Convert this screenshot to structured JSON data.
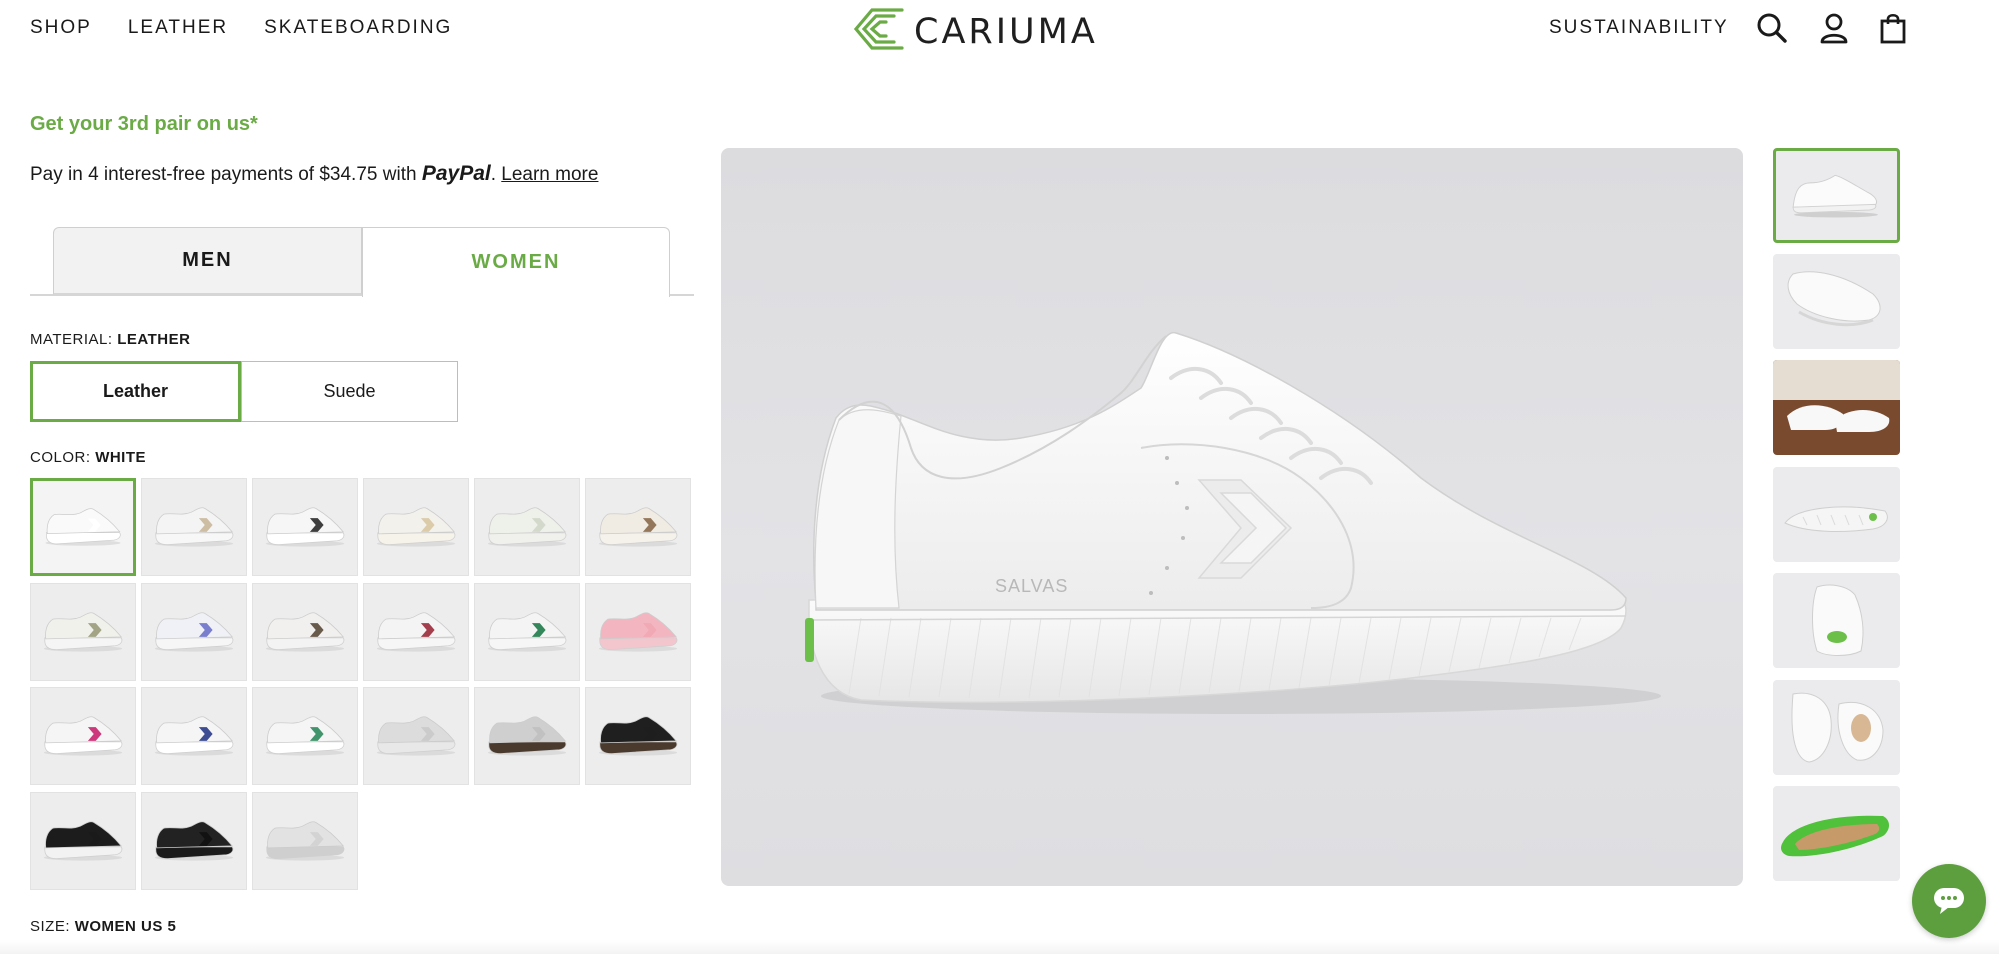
{
  "nav": {
    "left_links": [
      "SHOP",
      "LEATHER",
      "SKATEBOARDING"
    ],
    "right_link": "SUSTAINABILITY",
    "brand": "CARIUMA",
    "icons": [
      "search-icon",
      "account-icon",
      "shopping-bag-icon"
    ]
  },
  "promo": {
    "text": "Get your 3rd pair on us*"
  },
  "payment": {
    "prefix": "Pay in 4 interest-free payments of $34.75 with ",
    "brand": "PayPal",
    "suffix": ". ",
    "link": "Learn more"
  },
  "gender_tabs": [
    {
      "label": "MEN",
      "selected": false
    },
    {
      "label": "WOMEN",
      "selected": true
    }
  ],
  "material": {
    "label": "MATERIAL:",
    "value": "LEATHER",
    "options": [
      {
        "label": "Leather",
        "selected": true
      },
      {
        "label": "Suede",
        "selected": false
      }
    ]
  },
  "color": {
    "label": "COLOR:",
    "value": "WHITE",
    "swatch_count": 21,
    "selected_index": 0
  },
  "size": {
    "label": "SIZE:",
    "value": "WOMEN US 5"
  },
  "gallery": {
    "main_image": "white leather sneaker side view",
    "thumbnail_count": 7,
    "selected_thumbnail": 0
  },
  "colors": {
    "accent": "#6aab46",
    "chat": "#5d9e3f",
    "image_bg": "#e0e0e3"
  }
}
